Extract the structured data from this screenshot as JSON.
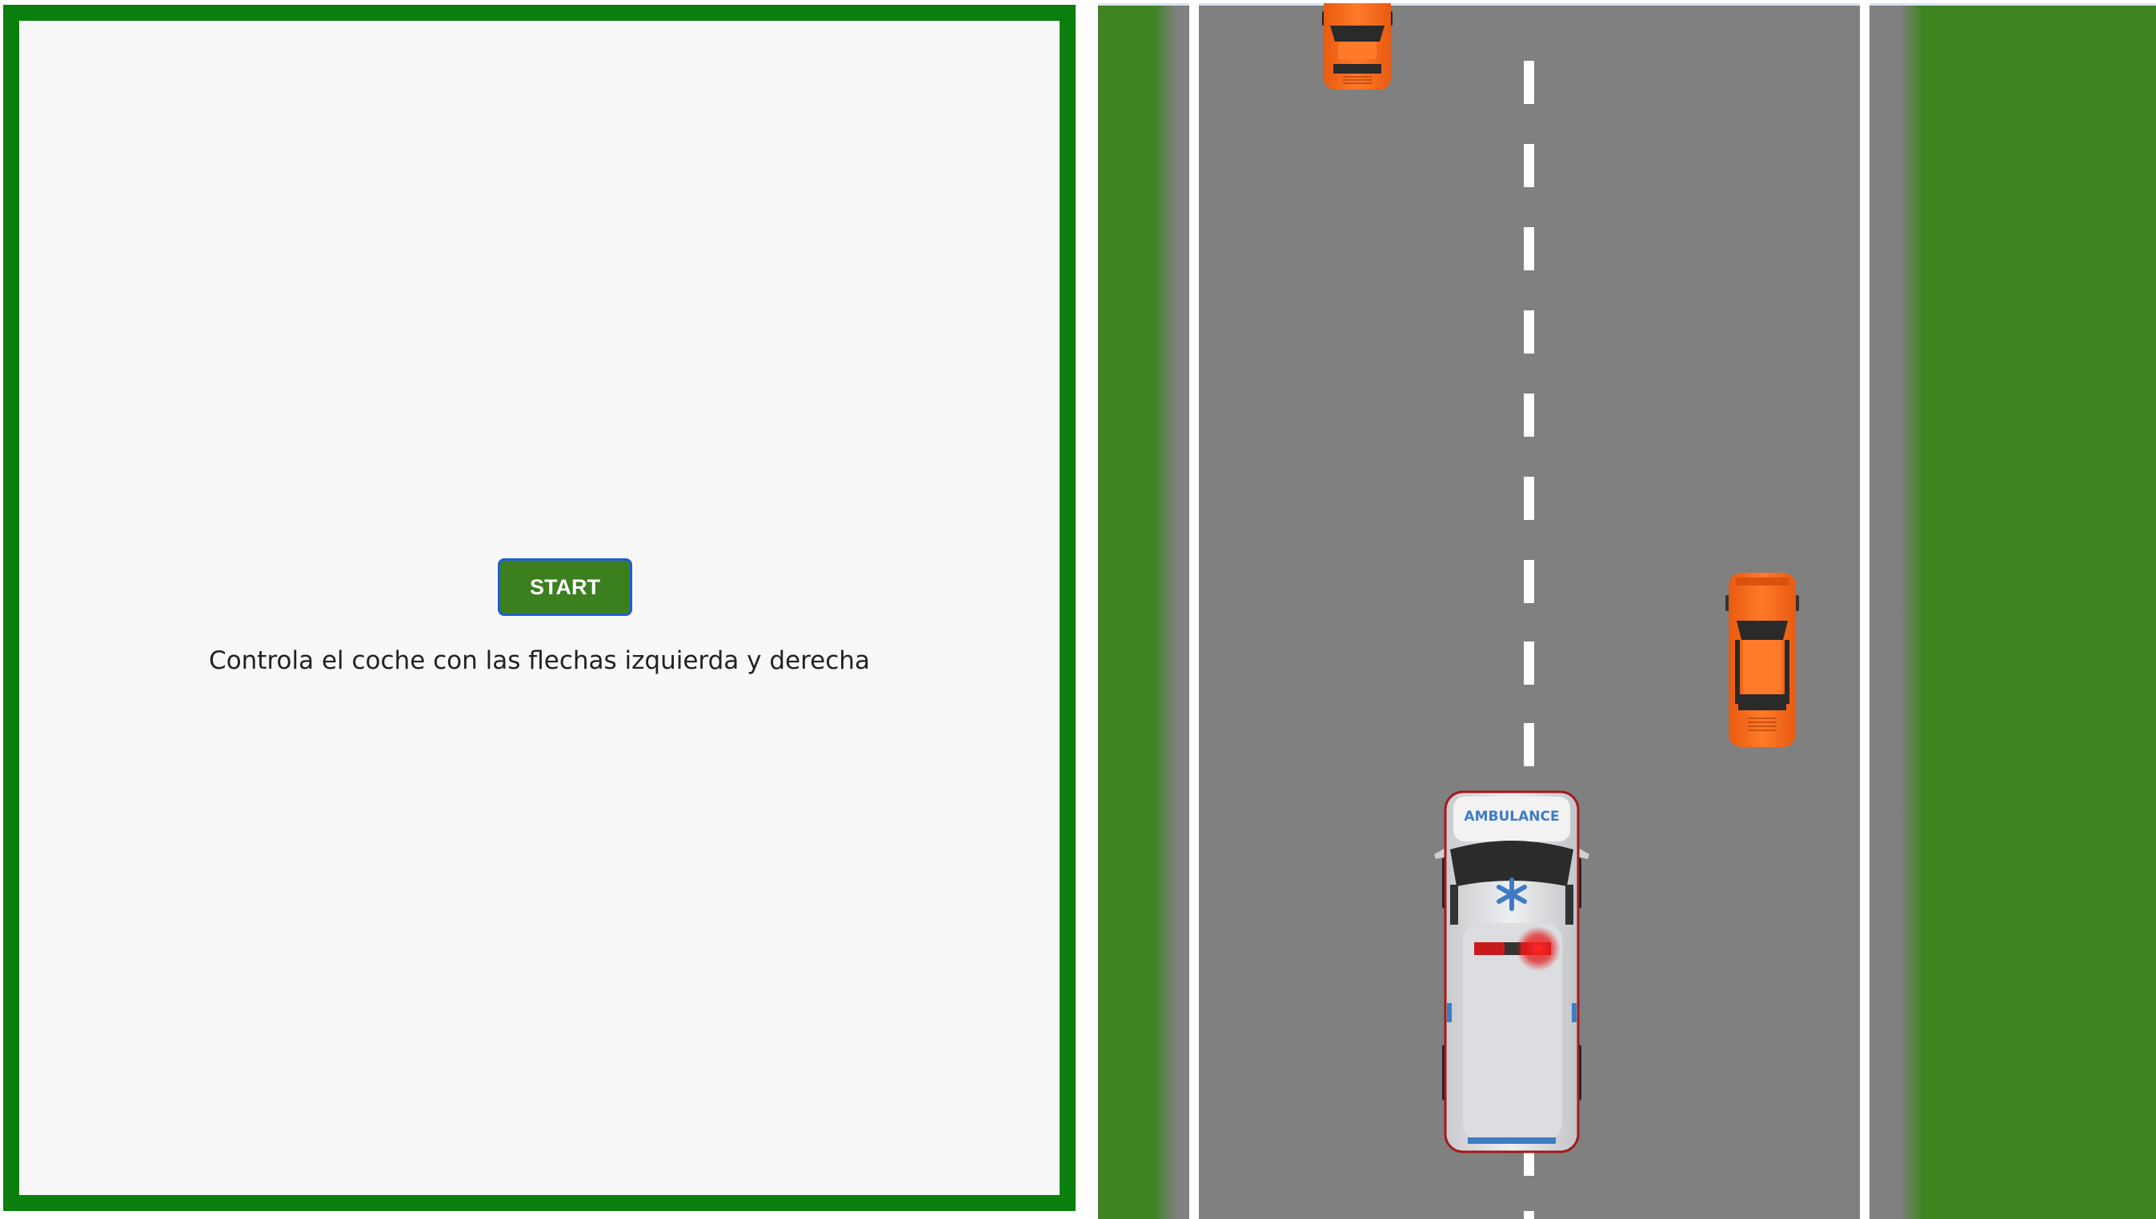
{
  "panel": {
    "start_label": "START",
    "instructions": "Controla el coche con las flechas izquierda y derecha"
  },
  "game": {
    "ambulance_text": "AMBULANCE",
    "colors": {
      "grass": "#3e8421",
      "road": "#808080",
      "lane_marking": "#ffffff",
      "panel_border": "#0a7f0d",
      "start_button": "#3b7f1f",
      "enemy_car": "#ff6a1a"
    },
    "icons": [
      "ambulance-icon",
      "orange-car-icon"
    ]
  }
}
